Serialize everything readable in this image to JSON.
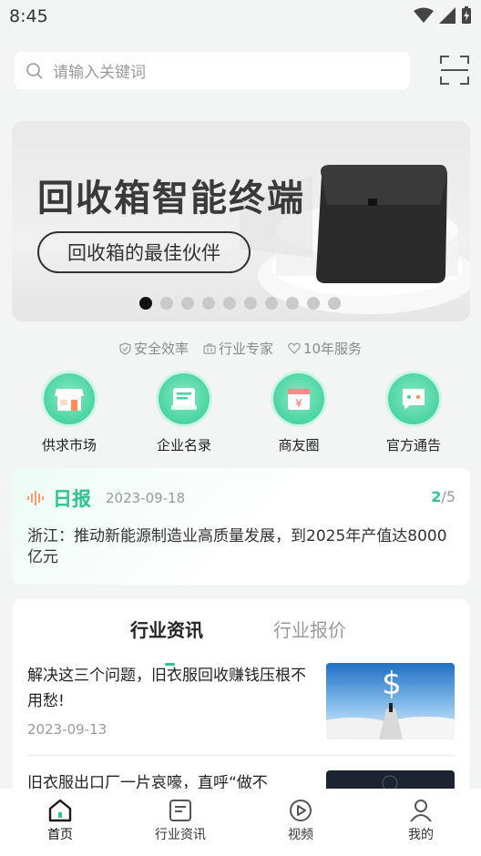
{
  "status": {
    "time": "8:45"
  },
  "search": {
    "placeholder": "请输入关键词"
  },
  "banner": {
    "title": "回收箱智能终端",
    "subtitle": "回收箱的最佳伙伴",
    "slides": 10,
    "active_slide": 1
  },
  "features": [
    "安全效率",
    "行业专家",
    "10年服务"
  ],
  "quick": [
    {
      "label": "供求市场",
      "icon": "shop-icon"
    },
    {
      "label": "企业名录",
      "icon": "directory-icon"
    },
    {
      "label": "商友圈",
      "icon": "circle-icon"
    },
    {
      "label": "官方通告",
      "icon": "notice-icon"
    }
  ],
  "daily": {
    "title": "日报",
    "date": "2023-09-18",
    "page_current": "2",
    "page_total": "/5",
    "text": "浙江：推动新能源制造业高质量发展，到2025年产值达8000亿元"
  },
  "news": {
    "tabs": [
      "行业资讯",
      "行业报价"
    ],
    "articles": [
      {
        "title": "解决这三个问题，旧衣服回收赚钱压根不用愁!",
        "date": "2023-09-13"
      },
      {
        "title": "旧衣服出口厂一片哀嚎，直呼“做不",
        "date": ""
      }
    ]
  },
  "tabbar": [
    {
      "label": "首页",
      "icon": "home-icon"
    },
    {
      "label": "行业资讯",
      "icon": "news-icon"
    },
    {
      "label": "视频",
      "icon": "video-icon"
    },
    {
      "label": "我的",
      "icon": "profile-icon"
    }
  ],
  "colors": {
    "accent": "#2dc58c",
    "background": "#f3f4f4"
  }
}
